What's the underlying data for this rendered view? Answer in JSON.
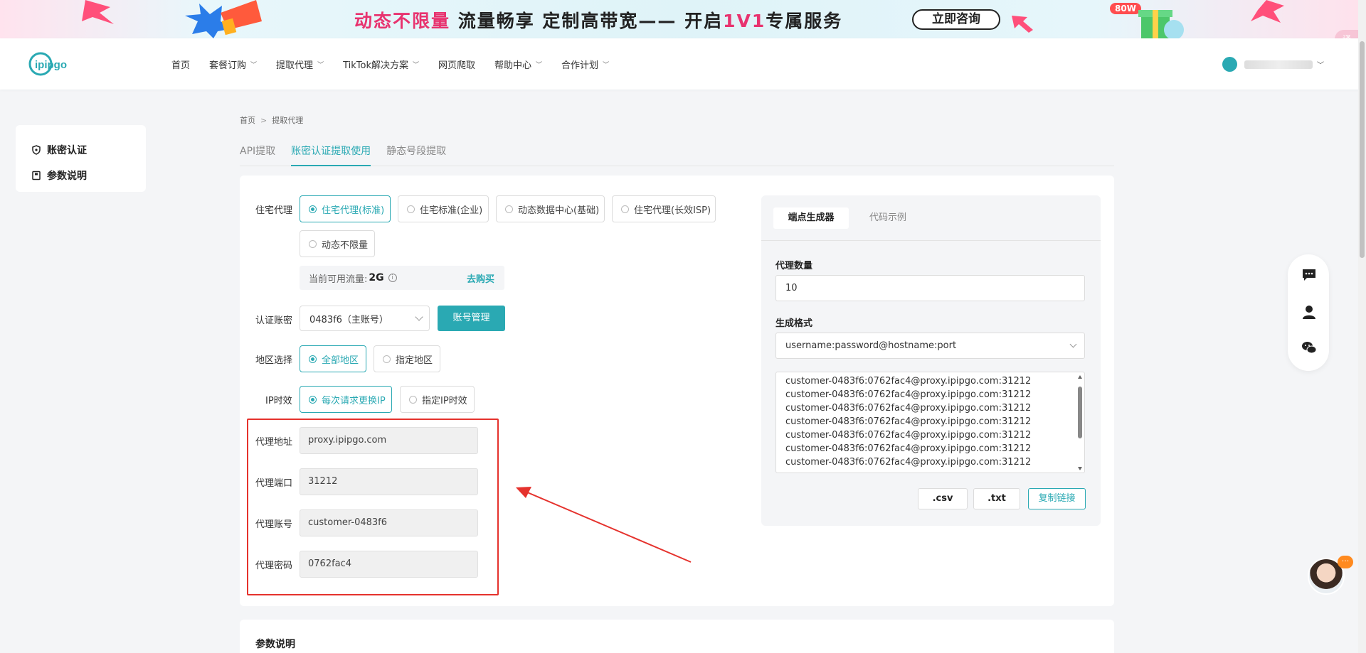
{
  "banner": {
    "title_part1": "动态不限量",
    "title_part2": " 流量畅享 定制高带宽—— 开启",
    "title_part3": "1V1",
    "title_part4": "专属服务",
    "cta": "立即咨询",
    "badge": "80W"
  },
  "header": {
    "logo": "ipipgo",
    "nav": [
      {
        "label": "首页",
        "has_dropdown": false
      },
      {
        "label": "套餐订购",
        "has_dropdown": true
      },
      {
        "label": "提取代理",
        "has_dropdown": true
      },
      {
        "label": "TikTok解决方案",
        "has_dropdown": true
      },
      {
        "label": "网页爬取",
        "has_dropdown": false
      },
      {
        "label": "帮助中心",
        "has_dropdown": true
      },
      {
        "label": "合作计划",
        "has_dropdown": true
      }
    ]
  },
  "sidebar": {
    "items": [
      {
        "label": "账密认证",
        "icon": "shield-icon"
      },
      {
        "label": "参数说明",
        "icon": "book-icon"
      }
    ]
  },
  "breadcrumb": {
    "home": "首页",
    "sep": ">",
    "current": "提取代理"
  },
  "tabs": [
    {
      "label": "API提取",
      "active": false
    },
    {
      "label": "账密认证提取使用",
      "active": true
    },
    {
      "label": "静态号段提取",
      "active": false
    }
  ],
  "form": {
    "proxy_type_label": "住宅代理",
    "proxy_types": [
      {
        "label": "住宅代理(标准)",
        "selected": true
      },
      {
        "label": "住宅标准(企业)",
        "selected": false
      },
      {
        "label": "动态数据中心(基础)",
        "selected": false
      },
      {
        "label": "住宅代理(长效ISP)",
        "selected": false
      },
      {
        "label": "动态不限量",
        "selected": false
      }
    ],
    "flow_label": "当前可用流量:",
    "flow_amount": "2G",
    "buy_link": "去购买",
    "account_label": "认证账密",
    "account_value": "0483f6（主账号）",
    "manage_button": "账号管理",
    "region_label": "地区选择",
    "region_options": [
      {
        "label": "全部地区",
        "selected": true
      },
      {
        "label": "指定地区",
        "selected": false
      }
    ],
    "ip_label": "IP时效",
    "ip_options": [
      {
        "label": "每次请求更换IP",
        "selected": true
      },
      {
        "label": "指定IP时效",
        "selected": false
      }
    ],
    "proxy_address_label": "代理地址",
    "proxy_address": "proxy.ipipgo.com",
    "proxy_port_label": "代理端口",
    "proxy_port": "31212",
    "proxy_user_label": "代理账号",
    "proxy_user": "customer-0483f6",
    "proxy_pass_label": "代理密码",
    "proxy_pass": "0762fac4"
  },
  "generator": {
    "tab_active": "端点生成器",
    "tab_other": "代码示例",
    "count_label": "代理数量",
    "count_value": "10",
    "format_label": "生成格式",
    "format_value": "username:password@hostname:port",
    "output_lines": [
      "customer-0483f6:0762fac4@proxy.ipipgo.com:31212",
      "customer-0483f6:0762fac4@proxy.ipipgo.com:31212",
      "customer-0483f6:0762fac4@proxy.ipipgo.com:31212",
      "customer-0483f6:0762fac4@proxy.ipipgo.com:31212",
      "customer-0483f6:0762fac4@proxy.ipipgo.com:31212",
      "customer-0483f6:0762fac4@proxy.ipipgo.com:31212",
      "customer-0483f6:0762fac4@proxy.ipipgo.com:31212"
    ],
    "btn_csv": ".csv",
    "btn_txt": ".txt",
    "btn_copy": "复制链接"
  },
  "params_section": {
    "title": "参数说明"
  },
  "colors": {
    "accent": "#2aa9b3",
    "highlight": "#e5322d",
    "pink": "#e8336f"
  },
  "float_icons": [
    "chat-icon",
    "user-service-icon",
    "wechat-icon"
  ]
}
